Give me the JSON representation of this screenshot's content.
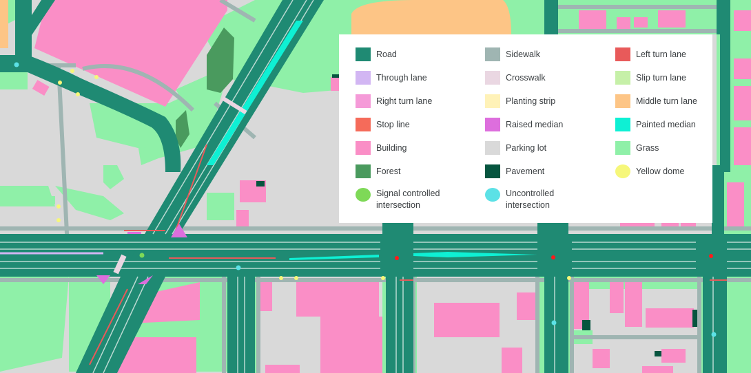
{
  "map": {
    "colors": {
      "road": "#1f8a73",
      "sidewalk": "#9fb5b2",
      "left_turn_lane": "#e85a5a",
      "through_lane": "#d2b6f3",
      "crosswalk": "#ead7e2",
      "slip_turn_lane": "#c6f0a8",
      "right_turn_lane": "#f59ad8",
      "planting_strip": "#fff2b8",
      "middle_turn_lane": "#fdc586",
      "stop_line": "#f56b5a",
      "raised_median": "#dd6edd",
      "painted_median": "#0ef0d4",
      "building": "#fa8ec6",
      "parking_lot": "#d9d9d9",
      "grass": "#8ff0a8",
      "forest": "#4a9a5e",
      "pavement": "#06553f",
      "yellow_dome": "#f6f77a",
      "signal_controlled_intersection": "#7ed957",
      "uncontrolled_intersection": "#5ce1e6",
      "lane_line": "#b9d9d1",
      "signal_dot": "#ff1a1a"
    }
  },
  "legend": {
    "items": [
      {
        "id": "road",
        "label": "Road",
        "color": "#1f8a73",
        "shape": "square"
      },
      {
        "id": "sidewalk",
        "label": "Sidewalk",
        "color": "#9fb5b2",
        "shape": "square"
      },
      {
        "id": "left-turn-lane",
        "label": "Left turn lane",
        "color": "#e85a5a",
        "shape": "square"
      },
      {
        "id": "through-lane",
        "label": "Through lane",
        "color": "#d2b6f3",
        "shape": "square"
      },
      {
        "id": "crosswalk",
        "label": "Crosswalk",
        "color": "#ead7e2",
        "shape": "square"
      },
      {
        "id": "slip-turn-lane",
        "label": "Slip turn lane",
        "color": "#c6f0a8",
        "shape": "square"
      },
      {
        "id": "right-turn-lane",
        "label": "Right turn lane",
        "color": "#f59ad8",
        "shape": "square"
      },
      {
        "id": "planting-strip",
        "label": "Planting strip",
        "color": "#fff2b8",
        "shape": "square"
      },
      {
        "id": "middle-turn-lane",
        "label": "Middle turn lane",
        "color": "#fdc586",
        "shape": "square"
      },
      {
        "id": "stop-line",
        "label": "Stop line",
        "color": "#f56b5a",
        "shape": "square"
      },
      {
        "id": "raised-median",
        "label": "Raised median",
        "color": "#dd6edd",
        "shape": "square"
      },
      {
        "id": "painted-median",
        "label": "Painted median",
        "color": "#0ef0d4",
        "shape": "square"
      },
      {
        "id": "building",
        "label": "Building",
        "color": "#fa8ec6",
        "shape": "square"
      },
      {
        "id": "parking-lot",
        "label": "Parking lot",
        "color": "#d9d9d9",
        "shape": "square"
      },
      {
        "id": "grass",
        "label": "Grass",
        "color": "#8ff0a8",
        "shape": "square"
      },
      {
        "id": "forest",
        "label": "Forest",
        "color": "#4a9a5e",
        "shape": "square"
      },
      {
        "id": "pavement",
        "label": "Pavement",
        "color": "#06553f",
        "shape": "square"
      },
      {
        "id": "yellow-dome",
        "label": "Yellow dome",
        "color": "#f6f77a",
        "shape": "circle"
      },
      {
        "id": "signal-controlled-intersection",
        "label": "Signal controlled intersection",
        "color": "#7ed957",
        "shape": "circle"
      },
      {
        "id": "uncontrolled-intersection",
        "label": "Uncontrolled intersection",
        "color": "#5ce1e6",
        "shape": "circle"
      }
    ]
  }
}
